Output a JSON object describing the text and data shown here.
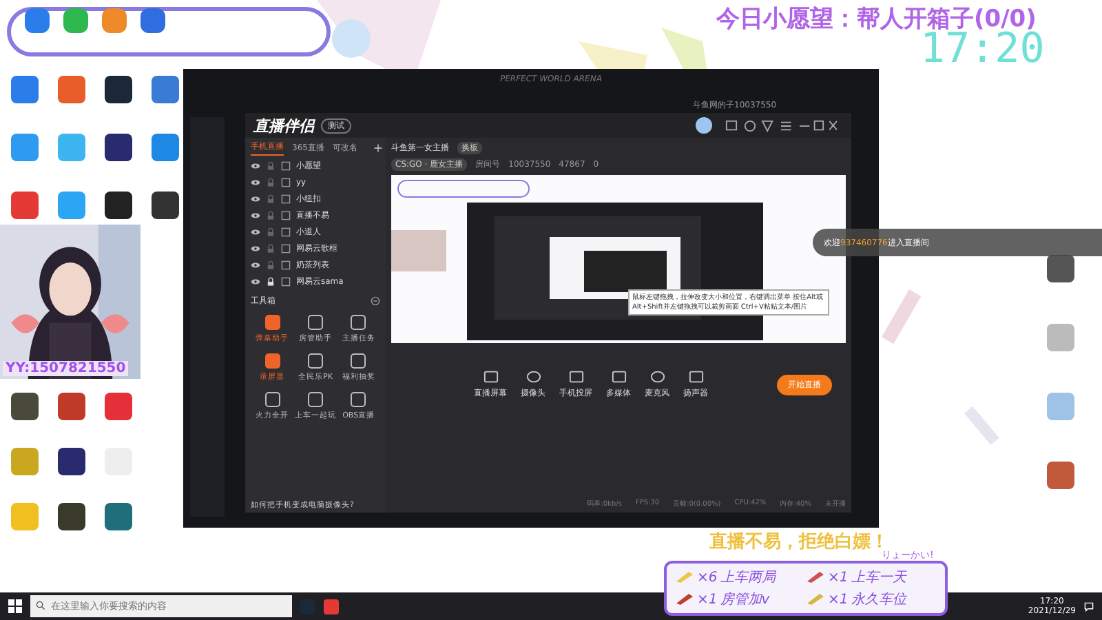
{
  "overlay": {
    "wish": "今日小愿望：帮人开箱子(0/0)",
    "clock": "17:20",
    "cam_id": "YY:1507821550",
    "slogan": "直播不易，拒绝白嫖！",
    "reply": "りょーかい!",
    "gifts": [
      {
        "count": "×6",
        "text": "上车两局",
        "color": "#e8c94a"
      },
      {
        "count": "×1",
        "text": "上车一天",
        "color": "#d05050"
      },
      {
        "count": "×1",
        "text": "房管加v",
        "color": "#c04030"
      },
      {
        "count": "×1",
        "text": "永久车位",
        "color": "#d9b640"
      }
    ],
    "welcome": {
      "prefix": "欢迎",
      "user": "937460776",
      "suffix": "进入直播间"
    }
  },
  "desktop": {
    "left_icons": [
      {
        "color": "#2b7de9"
      },
      {
        "color": "#e85d2a"
      },
      {
        "color": "#1b2838"
      },
      {
        "color": "#3a7bd5"
      },
      {
        "color": "#2f9bf0"
      },
      {
        "color": "#3cb5f0"
      },
      {
        "color": "#2a2a6e"
      },
      {
        "color": "#1e88e5"
      },
      {
        "color": "#e53935"
      },
      {
        "color": "#2aa6f5"
      },
      {
        "color": "#222222"
      },
      {
        "color": "#333333"
      }
    ],
    "lower_icons": [
      {
        "color": "#4a4a3a"
      },
      {
        "color": "#c03a2a"
      },
      {
        "color": "#e5303a"
      },
      {
        "color": "#c9a820"
      },
      {
        "color": "#2a2a6e"
      },
      {
        "color": "#eeeeee"
      },
      {
        "color": "#f0c020"
      },
      {
        "color": "#3a3a2a"
      },
      {
        "color": "#1f6f7a"
      }
    ],
    "right_icons": [
      {
        "color": "#555555"
      },
      {
        "color": "#bbbbbb"
      },
      {
        "color": "#9fc3e6"
      },
      {
        "color": "#c05a3a"
      }
    ]
  },
  "game_window": {
    "title": "PERFECT WORLD ARENA",
    "user": "斗鱼网的子10037550"
  },
  "app": {
    "name": "直播伴侣",
    "badge": "测试",
    "tabs": [
      {
        "label": "手机直播",
        "selected": true
      },
      {
        "label": "365直播",
        "selected": false
      },
      {
        "label": "可改名",
        "selected": false
      }
    ],
    "scenes": [
      {
        "name": "小愿望",
        "locked": false
      },
      {
        "name": "yy",
        "locked": false
      },
      {
        "name": "小纽扣",
        "locked": false
      },
      {
        "name": "直播不易",
        "locked": false
      },
      {
        "name": "小道人",
        "locked": false
      },
      {
        "name": "网易云歌框",
        "locked": false
      },
      {
        "name": "奶茶列表",
        "locked": false
      },
      {
        "name": "网易云sama",
        "locked": true
      }
    ],
    "toolbox_title": "工具箱",
    "tools": [
      {
        "label": "弹幕助手",
        "active": true
      },
      {
        "label": "房管助手",
        "active": false
      },
      {
        "label": "主播任务",
        "active": false
      },
      {
        "label": "录屏器",
        "active": true
      },
      {
        "label": "全民乐PK",
        "active": false
      },
      {
        "label": "福利抽奖",
        "active": false
      },
      {
        "label": "火力全开",
        "active": false
      },
      {
        "label": "上车一起玩",
        "active": false
      },
      {
        "label": "OBS直播",
        "active": false
      }
    ],
    "tip": "如何把手机变成电脑摄像头?",
    "room_title": "斗鱼第一女主播",
    "room_tag": "换板",
    "category": "CS:GO · 鹿女主播",
    "room_label": "房间号",
    "room_no": "10037550",
    "hot": "47867",
    "fans": "0",
    "preview_tip": "鼠标左键拖拽，拉伸改变大小和位置，右键调出菜单 按住Alt或Alt+Shift并左键拖拽可以裁剪画面 Ctrl+V粘贴文本/图片",
    "sources": [
      "直播屏幕",
      "摄像头",
      "手机投屏",
      "多媒体",
      "麦克风",
      "扬声器"
    ],
    "start": "开始直播",
    "status": [
      "码率:0kb/s",
      "FPS:30",
      "丢帧:0(0.00%)",
      "CPU:42%",
      "内存:40%",
      "未开播"
    ]
  },
  "taskbar": {
    "placeholder": "在这里输入你要搜索的内容",
    "time": "17:20",
    "date": "2021/12/29"
  }
}
